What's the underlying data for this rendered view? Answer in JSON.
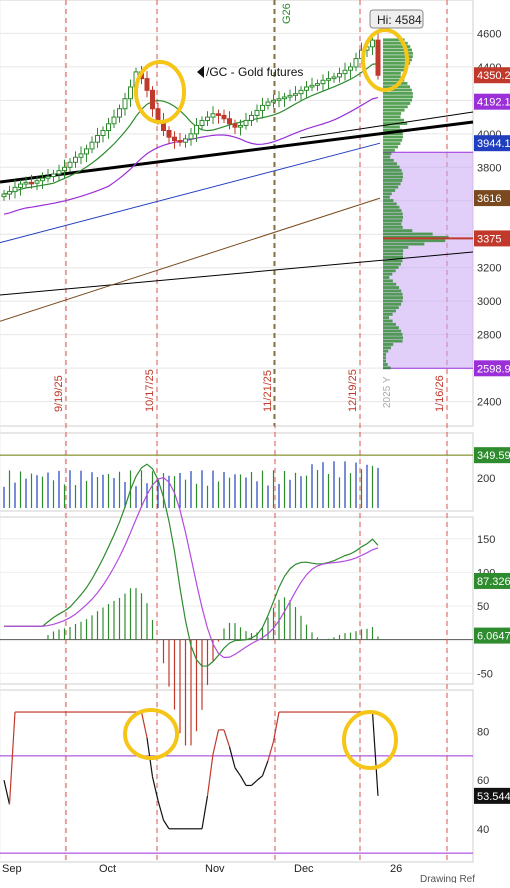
{
  "chart_data": {
    "type": "candlestick",
    "title": "/GC - Gold futures",
    "high_badge": "Hi: 4584",
    "contract_label": "G26",
    "year_label": "2025 Y",
    "vertical_date_labels": [
      "9/19/25",
      "10/17/25",
      "11/21/25",
      "12/19/25",
      "1/16/26"
    ],
    "price_axis": {
      "ticks": [
        2400,
        2600,
        2800,
        3000,
        3200,
        3400,
        3600,
        3800,
        4000,
        4200,
        4400,
        4600
      ],
      "tick_labels": [
        "2400",
        "2600",
        "2800",
        "3000",
        "3200",
        "3400",
        "3600",
        "3800",
        "4000",
        "4200",
        "4400",
        "4600"
      ],
      "range": [
        2290,
        4740
      ],
      "badges": [
        {
          "value": 4350.2,
          "label": "4350.2",
          "color": "#c0392b"
        },
        {
          "value": 4192.1,
          "label": "4192.1",
          "color": "#9b30d9"
        },
        {
          "value": 3944.1,
          "label": "3944.1",
          "color": "#1f3fbf"
        },
        {
          "value": 3616,
          "label": "3616",
          "color": "#7a4a1e"
        },
        {
          "value": 3375,
          "label": "3375",
          "color": "#c0392b"
        },
        {
          "value": 2598.9,
          "label": "2598.9",
          "color": "#9b30d9"
        }
      ]
    },
    "x_axis": {
      "month_labels": [
        "Sep",
        "Oct",
        "Nov",
        "Dec",
        "26"
      ]
    },
    "closes": [
      3640,
      3655,
      3680,
      3700,
      3710,
      3705,
      3720,
      3735,
      3745,
      3760,
      3780,
      3800,
      3830,
      3860,
      3880,
      3910,
      3950,
      3990,
      4020,
      4060,
      4100,
      4150,
      4210,
      4280,
      4370,
      4330,
      4260,
      4150,
      4080,
      4020,
      3980,
      3960,
      3950,
      3970,
      4000,
      4050,
      4080,
      4100,
      4120,
      4110,
      4090,
      4060,
      4040,
      4050,
      4080,
      4110,
      4140,
      4170,
      4190,
      4200,
      4210,
      4220,
      4230,
      4240,
      4260,
      4280,
      4290,
      4300,
      4320,
      4330,
      4340,
      4360,
      4380,
      4400,
      4450,
      4500,
      4520,
      4560,
      4350
    ],
    "volume_panel": {
      "ticks": [
        200
      ],
      "tick_labels": [
        "200"
      ],
      "badge": "349.59"
    },
    "macd_panel": {
      "ticks": [
        150,
        100,
        50,
        0,
        -50
      ],
      "tick_labels": [
        "150",
        "100",
        "50",
        "0",
        "-50"
      ],
      "badges": [
        {
          "label": "87.326",
          "color": "#2e8b2e"
        },
        {
          "label": "6.0647",
          "color": "#2e8b2e"
        }
      ]
    },
    "rsi_panel": {
      "ticks": [
        80,
        60,
        40
      ],
      "tick_labels": [
        "80",
        "60",
        "40"
      ],
      "badge": "53.544",
      "overbought": 70,
      "oversold": 30
    },
    "footer_text": "Drawing    Ref"
  },
  "colors": {
    "up_candle": "#2e8b2e",
    "down_candle": "#c0392b",
    "ma_green": "#2e8b2e",
    "ma_purple": "#9b30d9",
    "ma_blue": "#1f3fbf",
    "ma_brown": "#7a4a1e",
    "volume_profile": "#2e8b2e",
    "value_area": "#c9a7f5",
    "highlight_ring": "#f5c518"
  }
}
